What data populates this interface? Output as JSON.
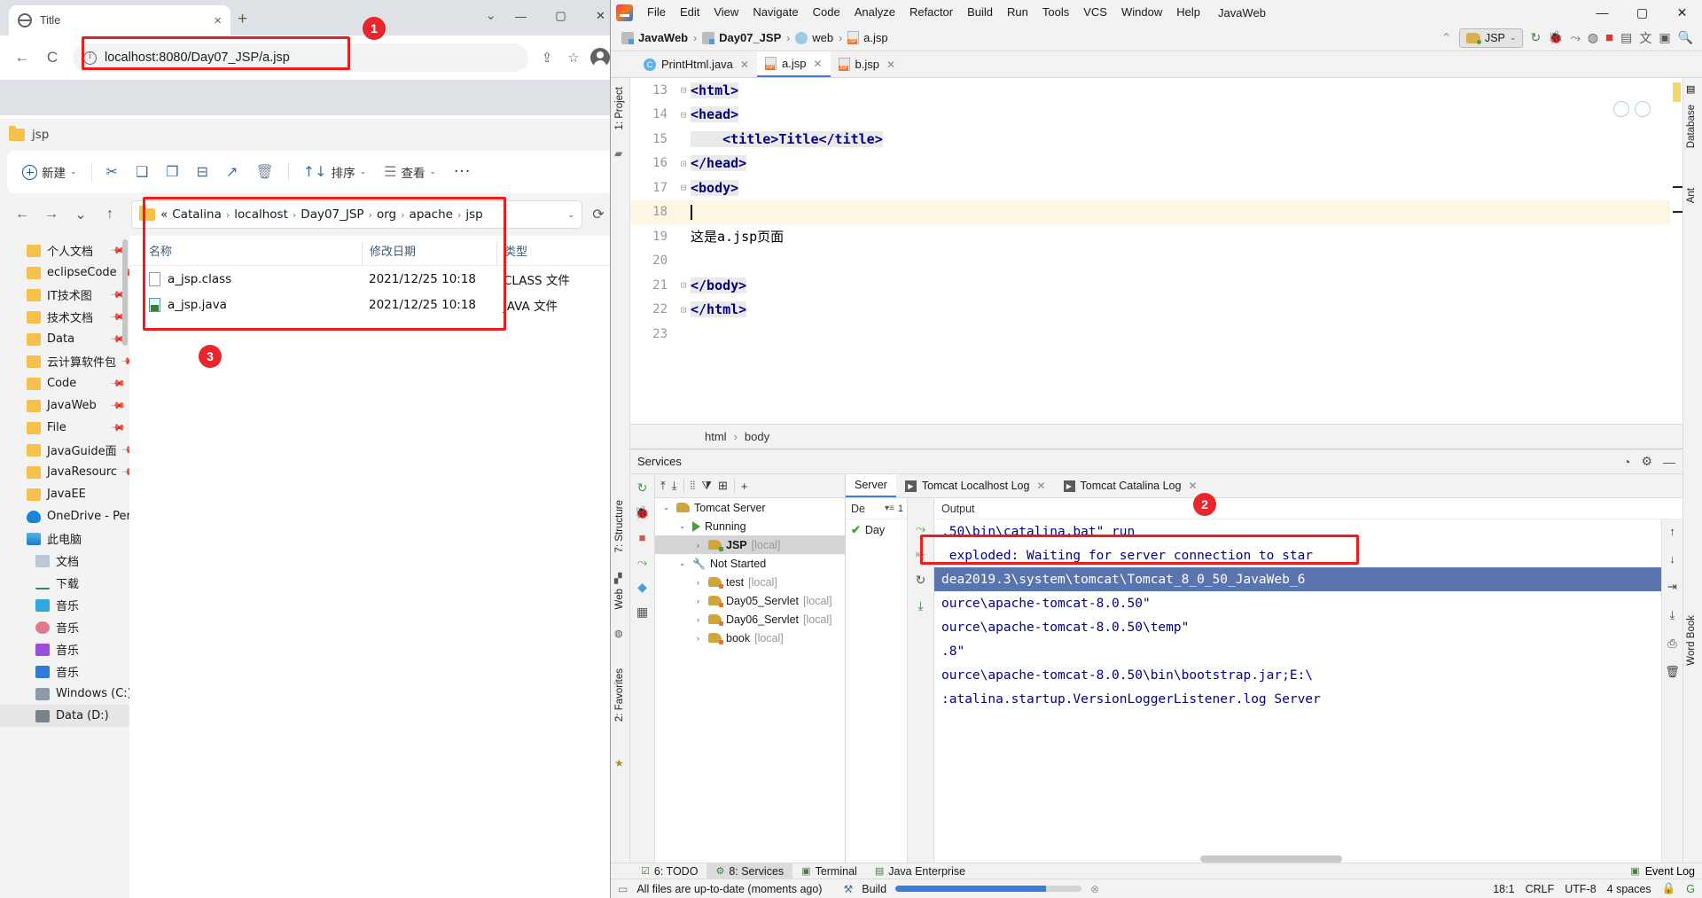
{
  "browser": {
    "tab_title": "Title",
    "url": "localhost:8080/Day07_JSP/a.jsp",
    "page_text": "这是a.jsp页面",
    "new_tab_label": "+",
    "close_label": "×",
    "minimize_label": "—",
    "maximize_label": "▢",
    "window_close_label": "✕",
    "back_label": "←",
    "forward_label": "→",
    "reload_label": "C",
    "share_label": "⇪",
    "star_label": "☆",
    "menu_label": "⋮",
    "tablist_chevron": "⌄"
  },
  "explorer": {
    "window_title": "jsp",
    "toolbar": {
      "new_label": "新建",
      "cut_label": "✂",
      "copy_label": "❑",
      "paste_label": "❐",
      "rename_label": "⊟",
      "share_label": "↗",
      "delete_label": "🗑",
      "sort_label": "排序",
      "view_label": "查看",
      "more_label": "···"
    },
    "address": {
      "back": "←",
      "forward": "→",
      "recent": "⌄",
      "up": "↑",
      "prefix": "«",
      "crumbs": [
        "Catalina",
        "localhost",
        "Day07_JSP",
        "org",
        "apache",
        "jsp"
      ],
      "dropdown": "⌄",
      "refresh": "⟳"
    },
    "sidebar": [
      {
        "label": "个人文档",
        "icon": "folder-icon",
        "pinned": true
      },
      {
        "label": "eclipseCode",
        "icon": "folder-icon",
        "pinned": true
      },
      {
        "label": "IT技术图",
        "icon": "folder-icon",
        "pinned": true
      },
      {
        "label": "技术文档",
        "icon": "folder-icon",
        "pinned": true
      },
      {
        "label": "Data",
        "icon": "folder-icon",
        "pinned": true
      },
      {
        "label": "云计算软件包",
        "icon": "folder-icon",
        "pinned": true
      },
      {
        "label": "Code",
        "icon": "folder-icon",
        "pinned": true
      },
      {
        "label": "JavaWeb",
        "icon": "folder-icon",
        "pinned": true
      },
      {
        "label": "File",
        "icon": "folder-icon",
        "pinned": true
      },
      {
        "label": "JavaGuide面",
        "icon": "folder-icon",
        "pinned": true
      },
      {
        "label": "JavaResourc",
        "icon": "folder-icon",
        "pinned": true
      },
      {
        "label": "JavaEE",
        "icon": "folder-icon",
        "pinned": false
      },
      {
        "label": "OneDrive - Pers",
        "icon": "onedrive-icon",
        "pinned": false
      },
      {
        "label": "此电脑",
        "icon": "this-pc-icon",
        "pinned": false
      },
      {
        "label": "文档",
        "icon": "documents-icon",
        "pinned": false,
        "indent": true
      },
      {
        "label": "下载",
        "icon": "downloads-icon",
        "pinned": false,
        "indent": true
      },
      {
        "label": "音乐",
        "icon": "desktop-icon",
        "pinned": false,
        "indent": true
      },
      {
        "label": "音乐",
        "icon": "music-icon",
        "pinned": false,
        "indent": true
      },
      {
        "label": "音乐",
        "icon": "video-icon",
        "pinned": false,
        "indent": true
      },
      {
        "label": "音乐",
        "icon": "pictures-icon",
        "pinned": false,
        "indent": true
      },
      {
        "label": "Windows (C:)",
        "icon": "system-drive-icon",
        "pinned": false,
        "indent": true
      },
      {
        "label": "Data (D:)",
        "icon": "drive-icon",
        "pinned": false,
        "indent": true,
        "selected": true
      }
    ],
    "columns": [
      "名称",
      "修改日期",
      "类型"
    ],
    "files": [
      {
        "name": "a_jsp.class",
        "date": "2021/12/25 10:18",
        "type": "CLASS 文件",
        "icon": "class-file-icon"
      },
      {
        "name": "a_jsp.java",
        "date": "2021/12/25 10:18",
        "type": "JAVA 文件",
        "icon": "java-file-icon"
      }
    ]
  },
  "annotations": {
    "badge1": "1",
    "badge2": "2",
    "badge3": "3",
    "accent_color": "#ee1c1c"
  },
  "idea": {
    "menu": [
      "File",
      "Edit",
      "View",
      "Navigate",
      "Code",
      "Analyze",
      "Refactor",
      "Build",
      "Run",
      "Tools",
      "VCS",
      "Window",
      "Help"
    ],
    "project_name": "JavaWeb",
    "window_controls": {
      "minimize": "—",
      "maximize": "▢",
      "close": "✕"
    },
    "navbar": {
      "crumbs": [
        "JavaWeb",
        "Day07_JSP",
        "web",
        "a.jsp"
      ],
      "build_icon": "hammer-icon",
      "run_config": "JSP",
      "run_icon": "run-icon",
      "debug_icon": "debug-icon",
      "rerun_icon": "rerun-icon",
      "coverage_icon": "coverage-icon",
      "stop_icon": "stop-icon",
      "deploy_icon": "deploy-icon",
      "translate_icon": "translate-icon",
      "layout_icon": "layout-icon",
      "search_icon": "search-icon"
    },
    "editor_tabs": [
      {
        "label": "PrintHtml.java",
        "icon": "java-class-icon",
        "active": false
      },
      {
        "label": "a.jsp",
        "icon": "jsp-file-icon",
        "active": true
      },
      {
        "label": "b.jsp",
        "icon": "jsp-file-icon",
        "active": false
      }
    ],
    "code": [
      {
        "num": "13",
        "fold": "⊟",
        "text": "<html>"
      },
      {
        "num": "14",
        "fold": "⊟",
        "text": "<head>"
      },
      {
        "num": "15",
        "fold": "",
        "text": "    <title>Title</title>"
      },
      {
        "num": "16",
        "fold": "⊡",
        "text": "</head>"
      },
      {
        "num": "17",
        "fold": "⊟",
        "text": "<body>"
      },
      {
        "num": "18",
        "fold": "",
        "text": "",
        "current": true,
        "caret": true
      },
      {
        "num": "19",
        "fold": "",
        "text": "这是a.jsp页面",
        "plain": true
      },
      {
        "num": "20",
        "fold": "",
        "text": ""
      },
      {
        "num": "21",
        "fold": "⊡",
        "text": "</body>"
      },
      {
        "num": "22",
        "fold": "⊡",
        "text": "</html>"
      },
      {
        "num": "23",
        "fold": "",
        "text": ""
      }
    ],
    "editor_breadcrumb": [
      "html",
      "body"
    ],
    "services": {
      "title": "Services",
      "settings_icon": "gear-icon",
      "help_icon": "help-icon",
      "minimize_icon": "minimize-icon",
      "toolbar_icons": [
        "expand-all-icon",
        "collapse-all-icon",
        "group-icon",
        "filter-icon",
        "add-tab-icon",
        "add-icon"
      ],
      "vtoolbar_icons": [
        "rerun-icon",
        "debug-icon",
        "stop-icon",
        "deploy-icon",
        "settings-icon",
        "layout-icon"
      ],
      "tree": [
        {
          "label": "Tomcat Server",
          "icon": "tomcat-icon",
          "level": 0,
          "twisty": "⌄"
        },
        {
          "label": "Running",
          "icon": "run-icon",
          "level": 1,
          "twisty": "⌄"
        },
        {
          "label": "JSP",
          "suffix": "[local]",
          "icon": "tomcat-run-icon",
          "level": 2,
          "twisty": "›",
          "selected": true,
          "bold": true
        },
        {
          "label": "Not Started",
          "icon": "wrench-icon",
          "level": 1,
          "twisty": "⌄"
        },
        {
          "label": "test",
          "suffix": "[local]",
          "icon": "tomcat-stop-icon",
          "level": 2,
          "twisty": "›"
        },
        {
          "label": "Day05_Servlet",
          "suffix": "[local]",
          "icon": "tomcat-stop-icon",
          "level": 2,
          "twisty": "›"
        },
        {
          "label": "Day06_Servlet",
          "suffix": "[local]",
          "icon": "tomcat-stop-icon",
          "level": 2,
          "twisty": "›"
        },
        {
          "label": "book",
          "suffix": "[local]",
          "icon": "tomcat-stop-icon",
          "level": 2,
          "twisty": "›"
        }
      ],
      "tabs": [
        {
          "label": "Server",
          "active": true,
          "icon": null
        },
        {
          "label": "Tomcat Localhost Log",
          "active": false,
          "icon": "play-icon",
          "closable": true
        },
        {
          "label": "Tomcat Catalina Log",
          "active": false,
          "icon": "play-icon",
          "closable": true
        }
      ],
      "deploy_col_header": "De",
      "deploy_count": "1",
      "deploy_row": "Day",
      "output_header": "Output",
      "console_lines": [
        {
          "text": ".50\\bin\\catalina.bat\" run",
          "selected": false
        },
        {
          "text": " exploded: Waiting for server connection to star",
          "selected": false
        },
        {
          "text": "dea2019.3\\system\\tomcat\\Tomcat_8_0_50_JavaWeb_6",
          "selected": true
        },
        {
          "text": "ource\\apache-tomcat-8.0.50\"",
          "selected": false
        },
        {
          "text": "ource\\apache-tomcat-8.0.50\\temp\"",
          "selected": false
        },
        {
          "text": ".8\"",
          "selected": false
        },
        {
          "text": "ource\\apache-tomcat-8.0.50\\bin\\bootstrap.jar;E:\\",
          "selected": false
        },
        {
          "text": ":atalina.startup.VersionLoggerListener.log Server",
          "selected": false
        }
      ]
    },
    "bottom_bar": [
      {
        "label": "6: TODO",
        "icon": "todo-icon",
        "active": false
      },
      {
        "label": "8: Services",
        "icon": "services-icon",
        "active": true
      },
      {
        "label": "Terminal",
        "icon": "terminal-icon",
        "active": false
      },
      {
        "label": "Java Enterprise",
        "icon": "java-ee-icon",
        "active": false
      }
    ],
    "event_log": "Event Log",
    "status": {
      "message": "All files are up-to-date (moments ago)",
      "build_label": "Build",
      "caret_pos": "18:1",
      "line_sep": "CRLF",
      "encoding": "UTF-8",
      "indent": "4 spaces",
      "lock_icon": "lock-icon",
      "branch_icon": "git-icon"
    },
    "side_tools": {
      "left_top": "1: Project",
      "left_mid": "7: Structure",
      "left_bot": "2: Favorites",
      "right_items": [
        "Database",
        "Ant",
        "Word Book"
      ],
      "web_label": "Web"
    }
  }
}
